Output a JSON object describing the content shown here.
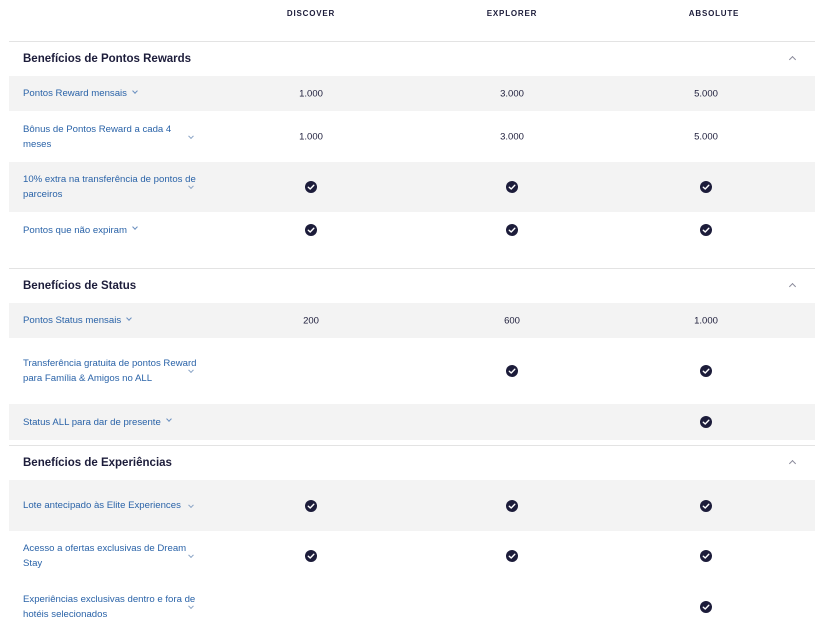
{
  "tiers": [
    "DISCOVER",
    "EXPLORER",
    "ABSOLUTE"
  ],
  "icons": {
    "check": "check-circle-icon",
    "expand": "chevron-down-icon",
    "collapse": "chevron-up-icon"
  },
  "colors": {
    "link": "#2a63a8",
    "check": "#1c1c3a",
    "row_shade": "#f3f3f3"
  },
  "sections": [
    {
      "title": "Benefícios de Pontos Rewards",
      "rows": [
        {
          "label": "Pontos Reward mensais",
          "values": [
            "1.000",
            "3.000",
            "5.000"
          ]
        },
        {
          "label": "Bônus de Pontos Reward a cada 4 meses",
          "values": [
            "1.000",
            "3.000",
            "5.000"
          ]
        },
        {
          "label": "10% extra na transferência de pontos de parceiros",
          "values": [
            "check",
            "check",
            "check"
          ]
        },
        {
          "label": "Pontos que não expiram",
          "values": [
            "check",
            "check",
            "check"
          ]
        }
      ]
    },
    {
      "title": "Benefícios de Status",
      "rows": [
        {
          "label": "Pontos Status mensais",
          "values": [
            "200",
            "600",
            "1.000"
          ]
        },
        {
          "label": "Transferência gratuita de pontos Reward para Família & Amigos no ALL",
          "values": [
            "",
            "check",
            "check"
          ]
        },
        {
          "label": "Status ALL para dar de presente",
          "values": [
            "",
            "",
            "check"
          ]
        }
      ]
    },
    {
      "title": "Benefícios de Experiências",
      "rows": [
        {
          "label": "Lote antecipado às Elite Experiences",
          "values": [
            "check",
            "check",
            "check"
          ]
        },
        {
          "label": "Acesso a ofertas exclusivas de Dream Stay",
          "values": [
            "check",
            "check",
            "check"
          ]
        },
        {
          "label": "Experiências exclusivas dentro e fora de hotéis selecionados",
          "values": [
            "",
            "",
            "check"
          ]
        }
      ]
    }
  ]
}
